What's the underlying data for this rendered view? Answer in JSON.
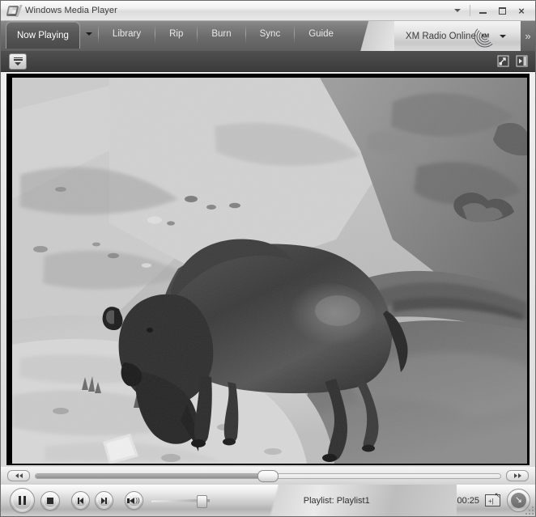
{
  "window": {
    "title": "Windows Media Player",
    "logo_icon": "wmp-logo-icon",
    "controls": {
      "menu_chevron_icon": "chevron-down-icon",
      "minimize_icon": "minimize-icon",
      "maximize_icon": "maximize-icon",
      "close_icon": "close-icon",
      "close_glyph": "×"
    }
  },
  "tabs": {
    "items": [
      {
        "label": "Now Playing",
        "active": true
      },
      {
        "label": "Library",
        "active": false
      },
      {
        "label": "Rip",
        "active": false
      },
      {
        "label": "Burn",
        "active": false
      },
      {
        "label": "Sync",
        "active": false
      },
      {
        "label": "Guide",
        "active": false
      }
    ],
    "now_playing_dropdown_icon": "chevron-down-icon",
    "online_store": {
      "label": "XM Radio Online",
      "logo_icon": "xm-radio-waves-icon",
      "logo_text": "XM",
      "dropdown_icon": "chevron-down-icon"
    },
    "overflow_icon": "double-chevron-right-icon",
    "overflow_glyph": "»"
  },
  "toolbar": {
    "menu_button_icon": "menu-list-dropdown-icon",
    "full_screen_icon": "full-screen-icon",
    "show_playlist_icon": "show-playlist-pane-icon"
  },
  "video": {
    "description": "Grayscale video of a bison standing on sandy ground beside a dark pool of water",
    "alt_label": "now-playing-video"
  },
  "seek": {
    "rewind_icon": "rewind-icon",
    "fast_forward_icon": "fast-forward-icon",
    "progress_percent": 50
  },
  "controls": {
    "pause_icon": "pause-icon",
    "stop_icon": "stop-icon",
    "previous_icon": "previous-track-icon",
    "next_icon": "next-track-icon",
    "volume_icon": "volume-speaker-icon",
    "volume_percent": 85,
    "status_text": "Playlist: Playlist1",
    "time_text": "00:25",
    "compact_mode_icon": "switch-to-compact-mode-icon",
    "skin_mode_icon": "switch-to-skin-mode-icon",
    "skin_mode_glyph": "↘",
    "resize_grip_icon": "resize-grip-icon"
  },
  "colors": {
    "tabstrip_bg": "#6b6b6b",
    "toolbar_bg": "#454545",
    "video_bg": "#000000",
    "chrome_light": "#ededed",
    "title_text": "#3a3a3a"
  }
}
